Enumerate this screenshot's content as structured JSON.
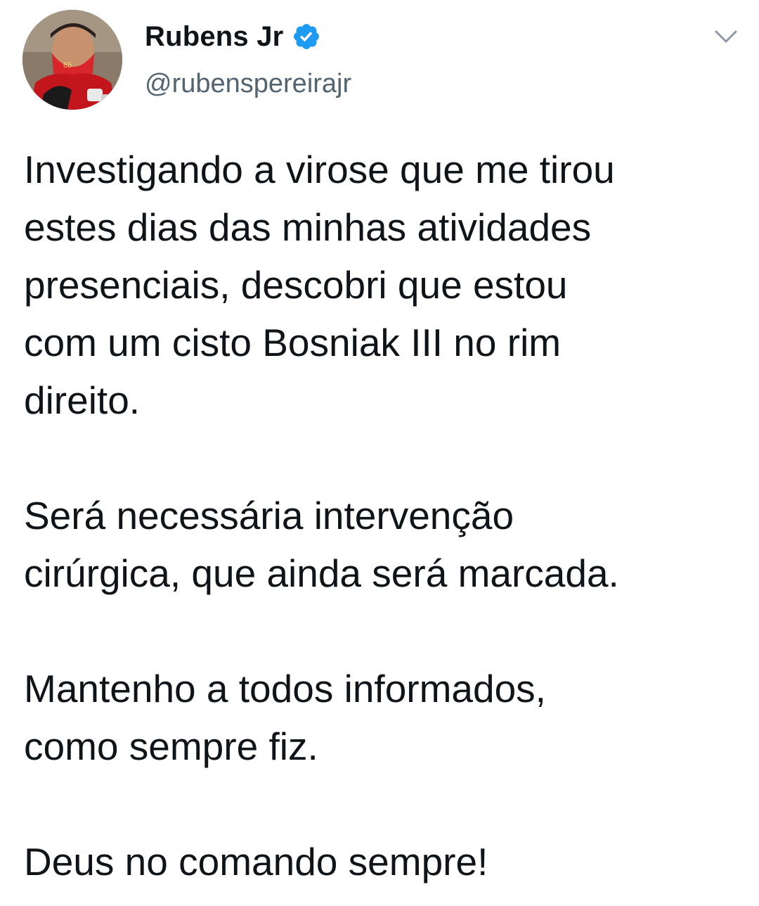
{
  "author": {
    "display_name": "Rubens Jr",
    "handle": "@rubenspereirajr",
    "verified": true,
    "avatar_icon": "profile-photo"
  },
  "menu": {
    "icon": "chevron-down-icon"
  },
  "tweet": {
    "paragraphs": [
      "Investigando a virose que me tirou\nestes dias das minhas atividades\npresenciais, descobri que estou\ncom um cisto Bosniak III no rim\ndireito.",
      "Será necessária intervenção\ncirúrgica, que ainda será marcada.",
      "Mantenho a todos informados,\ncomo sempre fiz.",
      "Deus no comando sempre!"
    ]
  },
  "colors": {
    "text": "#0f1419",
    "secondary_text": "#536471",
    "verified_blue": "#1d9bf0",
    "caret": "#8b98a5"
  }
}
